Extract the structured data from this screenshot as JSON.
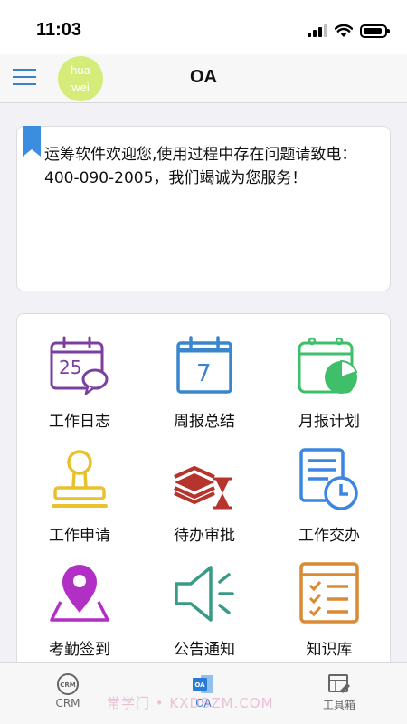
{
  "status_bar": {
    "time": "11:03",
    "battery_level": 0.9
  },
  "header": {
    "avatar_line1": "hua",
    "avatar_line2": "wei",
    "title": "OA"
  },
  "notice": {
    "text": "运筹软件欢迎您,使用过程中存在问题请致电：400-090-2005，我们竭诚为您服务！"
  },
  "modules": [
    {
      "label": "工作日志",
      "icon": "calendar-chat-icon",
      "color": "#7b3fa0"
    },
    {
      "label": "周报总结",
      "icon": "calendar-7-icon",
      "color": "#3a86cc"
    },
    {
      "label": "月报计划",
      "icon": "calendar-pie-icon",
      "color": "#3fbf6a"
    },
    {
      "label": "工作申请",
      "icon": "stamp-icon",
      "color": "#e8c22e"
    },
    {
      "label": "待办审批",
      "icon": "hourglass-stack-icon",
      "color": "#b5342c"
    },
    {
      "label": "工作交办",
      "icon": "document-clock-icon",
      "color": "#3a86e0"
    },
    {
      "label": "考勤签到",
      "icon": "map-pin-icon",
      "color": "#b12fc4"
    },
    {
      "label": "公告通知",
      "icon": "speaker-icon",
      "color": "#3a9a88"
    },
    {
      "label": "知识库",
      "icon": "checklist-window-icon",
      "color": "#d98a32"
    }
  ],
  "tabs": [
    {
      "label": "CRM",
      "icon": "crm-icon",
      "active": false
    },
    {
      "label": "OA",
      "icon": "oa-icon",
      "active": true
    },
    {
      "label": "工具箱",
      "icon": "toolbox-icon",
      "active": false
    }
  ],
  "crm_icon_text": "CRM",
  "oa_icon_text": "OA",
  "watermark": "常学门 • KXDBZM.COM",
  "colors": {
    "accent": "#2a7bd4",
    "avatar": "#d6ec7a"
  }
}
